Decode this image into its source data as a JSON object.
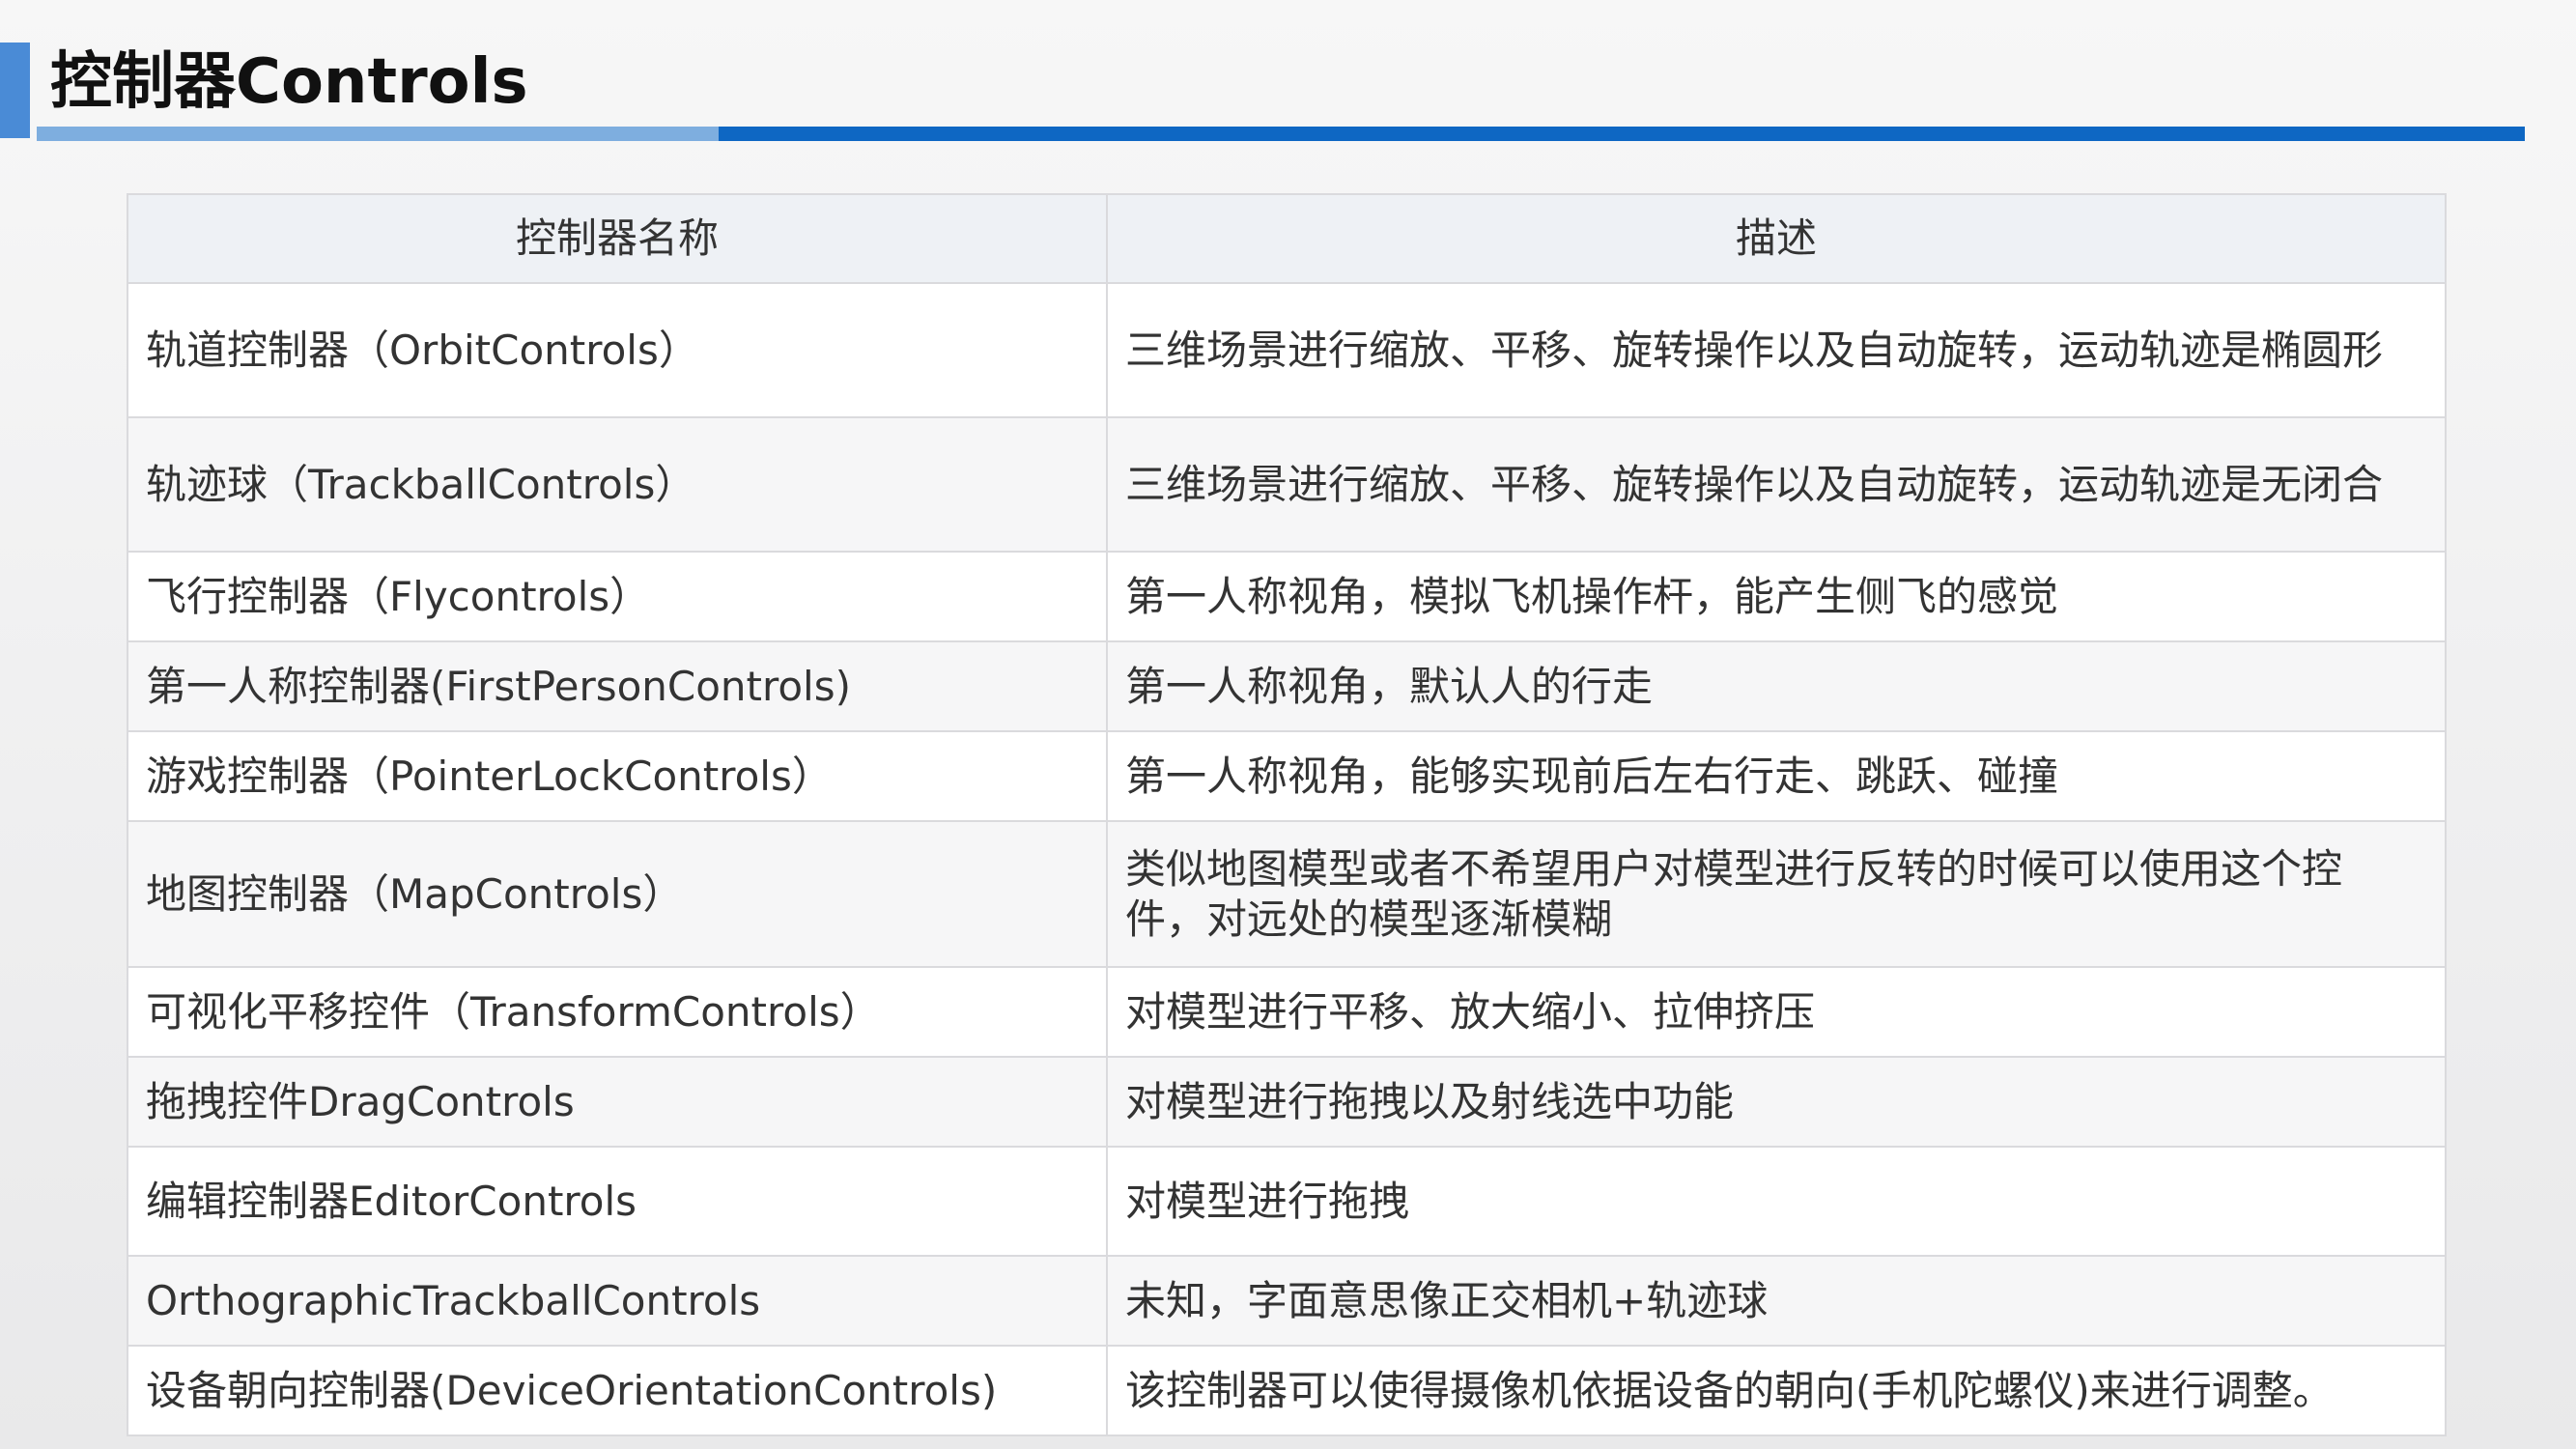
{
  "slide": {
    "title": "控制器Controls"
  },
  "table": {
    "headers": [
      "控制器名称",
      "描述"
    ],
    "rows": [
      {
        "name": "轨道控制器（OrbitControls）",
        "desc": "三维场景进行缩放、平移、旋转操作以及自动旋转，运动轨迹是椭圆形"
      },
      {
        "name": "轨迹球（TrackballControls）",
        "desc": "三维场景进行缩放、平移、旋转操作以及自动旋转，运动轨迹是无闭合"
      },
      {
        "name": "飞行控制器（Flycontrols）",
        "desc": "第一人称视角，模拟飞机操作杆，能产生侧飞的感觉"
      },
      {
        "name": "第一人称控制器(FirstPersonControls)",
        "desc": "第一人称视角，默认人的行走"
      },
      {
        "name": "游戏控制器（PointerLockControls）",
        "desc": "第一人称视角，能够实现前后左右行走、跳跃、碰撞"
      },
      {
        "name": "地图控制器（MapControls）",
        "desc": "类似地图模型或者不希望用户对模型进行反转的时候可以使用这个控件，对远处的模型逐渐模糊"
      },
      {
        "name": "可视化平移控件（TransformControls）",
        "desc": "对模型进行平移、放大缩小、拉伸挤压"
      },
      {
        "name": "拖拽控件DragControls",
        "desc": "对模型进行拖拽以及射线选中功能"
      },
      {
        "name": "编辑控制器EditorControls",
        "desc": "对模型进行拖拽"
      },
      {
        "name": "OrthographicTrackballControls",
        "desc": "未知，字面意思像正交相机+轨迹球"
      },
      {
        "name": "设备朝向控制器(DeviceOrientationControls)",
        "desc": "该控制器可以使得摄像机依据设备的朝向(手机陀螺仪)来进行调整。"
      }
    ]
  }
}
